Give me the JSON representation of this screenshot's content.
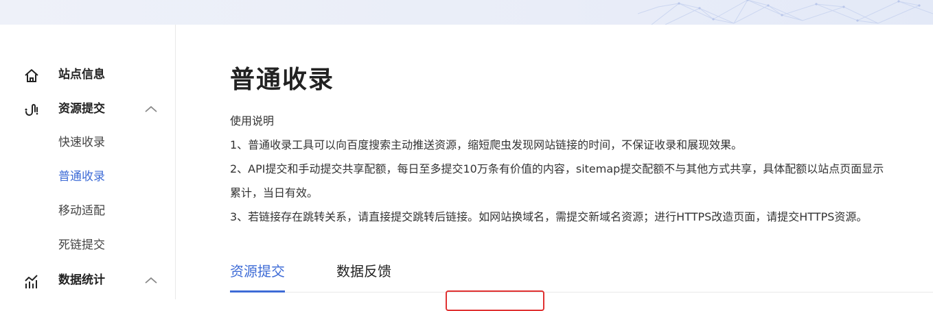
{
  "sidebar": {
    "groups": [
      {
        "label": "站点信息",
        "icon": "home-icon",
        "expanded": null
      },
      {
        "label": "资源提交",
        "icon": "resource-submit-icon",
        "expanded": true,
        "items": [
          {
            "label": "快速收录",
            "active": false
          },
          {
            "label": "普通收录",
            "active": true
          },
          {
            "label": "移动适配",
            "active": false
          },
          {
            "label": "死链提交",
            "active": false
          }
        ]
      },
      {
        "label": "数据统计",
        "icon": "stats-icon",
        "expanded": true
      }
    ]
  },
  "main": {
    "title": "普通收录",
    "description": [
      "使用说明",
      "1、普通收录工具可以向百度搜索主动推送资源，缩短爬虫发现网站链接的时间，不保证收录和展现效果。",
      "2、API提交和手动提交共享配额，每日至多提交10万条有价值的内容，sitemap提交配额不与其他方式共享，具体配额以站点页面显示",
      "累计，当日有效。",
      "3、若链接存在跳转关系，请直接提交跳转后链接。如网站换域名，需提交新域名资源；进行HTTPS改造页面，请提交HTTPS资源。"
    ],
    "tabs": [
      {
        "label": "资源提交",
        "active": true
      },
      {
        "label": "数据反馈",
        "active": false
      }
    ]
  },
  "colors": {
    "accent": "#3d6bd6",
    "highlight_box": "#e03030"
  }
}
